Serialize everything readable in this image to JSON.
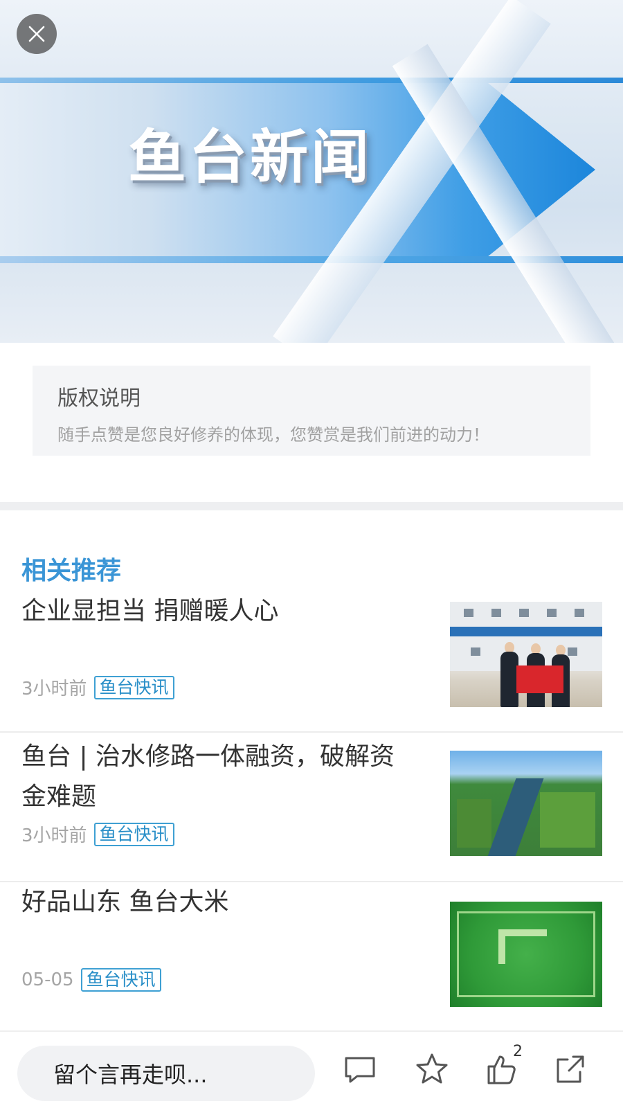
{
  "banner": {
    "title": "鱼台新闻"
  },
  "copyright": {
    "heading": "版权说明",
    "text": "随手点赞是您良好修养的体现，您赞赏是我们前进的动力！"
  },
  "recommend": {
    "title": "相关推荐",
    "items": [
      {
        "title": "企业显担当 捐赠暖人心",
        "time": "3小时前",
        "tag": "鱼台快讯"
      },
      {
        "title": "鱼台 | 治水修路一体融资，破解资金难题",
        "time": "3小时前",
        "tag": "鱼台快讯"
      },
      {
        "title": "好品山东 鱼台大米",
        "time": "05-05",
        "tag": "鱼台快讯"
      }
    ]
  },
  "bottom_bar": {
    "comment_placeholder": "留个言再走呗...",
    "like_count": "2"
  }
}
